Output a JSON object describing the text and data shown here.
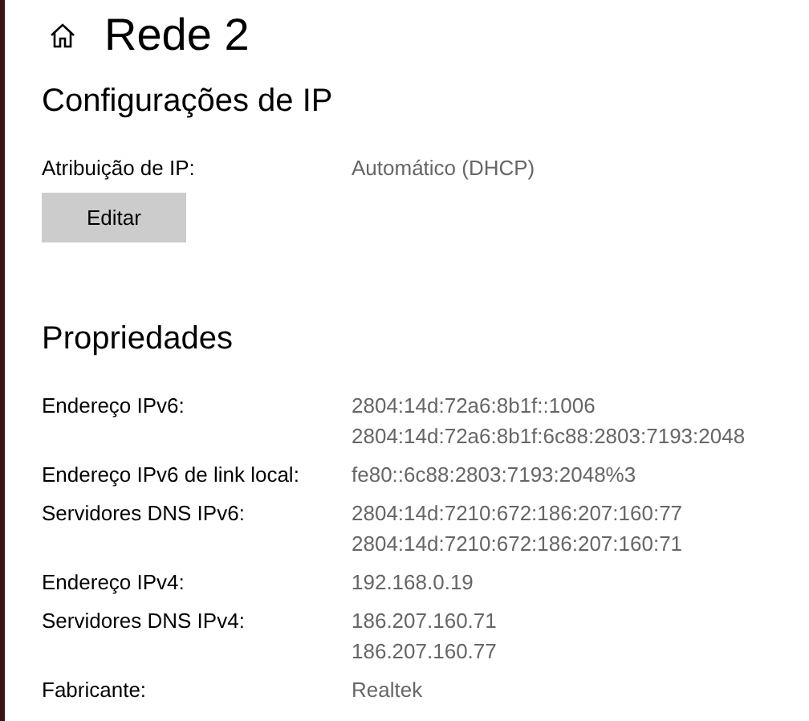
{
  "header": {
    "title": "Rede 2"
  },
  "ip_settings": {
    "heading": "Configurações de IP",
    "label": "Atribuição de IP:",
    "value": "Automático (DHCP)",
    "button": "Editar"
  },
  "properties": {
    "heading": "Propriedades",
    "rows": [
      {
        "label": "Endereço IPv6:",
        "values": [
          "2804:14d:72a6:8b1f::1006",
          "2804:14d:72a6:8b1f:6c88:2803:7193:2048"
        ]
      },
      {
        "label": "Endereço IPv6 de link local:",
        "values": [
          "fe80::6c88:2803:7193:2048%3"
        ]
      },
      {
        "label": "Servidores DNS IPv6:",
        "values": [
          "2804:14d:7210:672:186:207:160:77",
          "2804:14d:7210:672:186:207:160:71"
        ]
      },
      {
        "label": "Endereço IPv4:",
        "values": [
          "192.168.0.19"
        ]
      },
      {
        "label": "Servidores DNS IPv4:",
        "values": [
          "186.207.160.71",
          "186.207.160.77"
        ]
      },
      {
        "label": "Fabricante:",
        "values": [
          "Realtek"
        ]
      }
    ]
  }
}
